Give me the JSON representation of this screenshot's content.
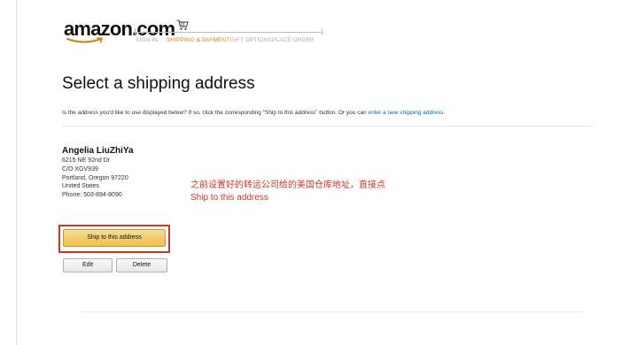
{
  "header": {
    "logo_text": "amazon.com",
    "steps": [
      {
        "label": "SIGN IN",
        "active": false
      },
      {
        "label": "SHIPPING & PAYMENT",
        "active": true
      },
      {
        "label": "GIFT OPTIONS",
        "active": false
      },
      {
        "label": "PLACE ORDER",
        "active": false
      }
    ]
  },
  "main": {
    "title": "Select a shipping address",
    "intro_text": "Is the address you'd like to use displayed below? If so, click the corresponding \"Ship to this address\" button. Or you can ",
    "intro_link": "enter a new shipping address",
    "intro_end": "."
  },
  "address": {
    "name": "Angelia LiuZhiYa",
    "line1": "6215 NE 92nd Dr",
    "line2": "C/O XGV939",
    "line3": "Portland, Oregon 97220",
    "line4": "United States",
    "phone": "Phone: 503-894-8090",
    "ship_button": "Ship to this address",
    "edit_button": "Edit",
    "delete_button": "Delete"
  },
  "annotation": {
    "line1": "之前设置好的转运公司给的美国仓库地址，直接点",
    "line2": "Ship to this address"
  },
  "colors": {
    "accent": "#e47911",
    "annotation": "#c0392b",
    "link": "#0066c0",
    "button": "#f0c14b"
  }
}
